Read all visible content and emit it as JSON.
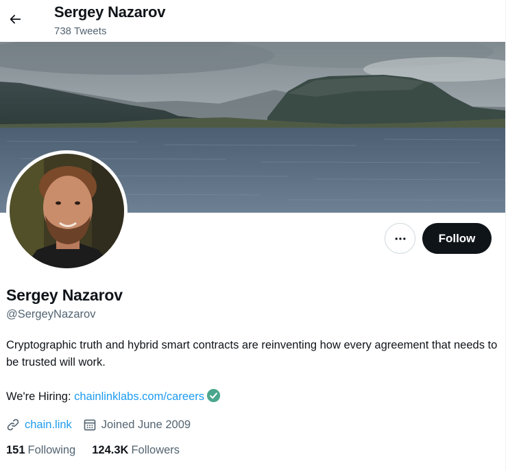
{
  "header": {
    "title": "Sergey Nazarov",
    "tweet_count": "738 Tweets",
    "back_icon": "arrow-left-icon"
  },
  "banner": {
    "description_icon": "banner-image"
  },
  "avatar": {
    "icon": "avatar-photo"
  },
  "actions": {
    "more_icon": "more-horizontal-icon",
    "follow_label": "Follow"
  },
  "profile": {
    "name": "Sergey Nazarov",
    "handle": "@SergeyNazarov",
    "bio_line1": "Cryptographic truth and hybrid smart contracts are reinventing how every agreement that needs to be trusted will work.",
    "bio_hiring_prefix": "We're Hiring: ",
    "bio_hiring_link": "chainlinklabs.com/careers",
    "verified_icon": "check-circle-icon"
  },
  "meta": {
    "website": "chain.link",
    "website_icon": "link-icon",
    "joined": "Joined June 2009",
    "joined_icon": "calendar-icon"
  },
  "stats": {
    "following_count": "151",
    "following_label": "Following",
    "followers_count": "124.3K",
    "followers_label": "Followers"
  },
  "colors": {
    "accent": "#1d9bf0",
    "text": "#0f1419",
    "secondary": "#536471",
    "verified": "#4aa68d",
    "follow_bg": "#0f1419"
  }
}
